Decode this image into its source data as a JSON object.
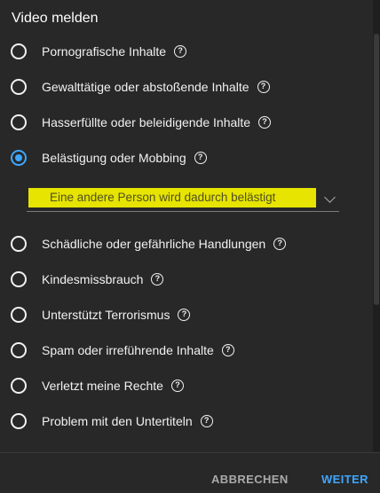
{
  "dialog": {
    "title": "Video melden"
  },
  "options": [
    {
      "label": "Pornografische Inhalte",
      "checked": false
    },
    {
      "label": "Gewalttätige oder abstoßende Inhalte",
      "checked": false
    },
    {
      "label": "Hasserfüllte oder beleidigende Inhalte",
      "checked": false
    },
    {
      "label": "Belästigung oder Mobbing",
      "checked": true
    },
    {
      "label": "Schädliche oder gefährliche Handlungen",
      "checked": false
    },
    {
      "label": "Kindesmissbrauch",
      "checked": false
    },
    {
      "label": "Unterstützt Terrorismus",
      "checked": false
    },
    {
      "label": "Spam oder irreführende Inhalte",
      "checked": false
    },
    {
      "label": "Verletzt meine Rechte",
      "checked": false
    },
    {
      "label": "Problem mit den Untertiteln",
      "checked": false
    }
  ],
  "help_glyph": "?",
  "subcategory": {
    "selected": "Eine andere Person wird dadurch belästigt"
  },
  "footer": {
    "cancel_label": "ABBRECHEN",
    "next_label": "WEITER"
  },
  "colors": {
    "accent": "#3ea6ff",
    "highlight": "#e6e400",
    "background": "#282828"
  }
}
